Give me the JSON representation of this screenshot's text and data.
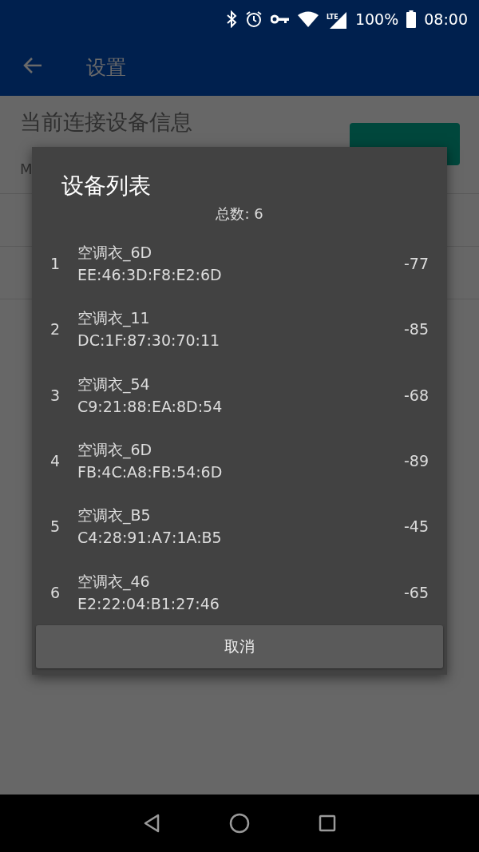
{
  "status_bar": {
    "network": "LTE",
    "battery": "100%",
    "time": "08:00"
  },
  "app_bar": {
    "title": "设置"
  },
  "settings": {
    "section_title": "当前连接设备信息",
    "mac_line": "M"
  },
  "dialog": {
    "title": "设备列表",
    "total": "总数: 6",
    "devices": [
      {
        "index": "1",
        "name": "空调衣_6D",
        "address": "EE:46:3D:F8:E2:6D",
        "rssi": "-77"
      },
      {
        "index": "2",
        "name": "空调衣_11",
        "address": "DC:1F:87:30:70:11",
        "rssi": "-85"
      },
      {
        "index": "3",
        "name": "空调衣_54",
        "address": "C9:21:88:EA:8D:54",
        "rssi": "-68"
      },
      {
        "index": "4",
        "name": "空调衣_6D",
        "address": "FB:4C:A8:FB:54:6D",
        "rssi": "-89"
      },
      {
        "index": "5",
        "name": "空调衣_B5",
        "address": "C4:28:91:A7:1A:B5",
        "rssi": "-45"
      },
      {
        "index": "6",
        "name": "空调衣_46",
        "address": "E2:22:04:B1:27:46",
        "rssi": "-65"
      }
    ],
    "cancel_button": "取消"
  }
}
